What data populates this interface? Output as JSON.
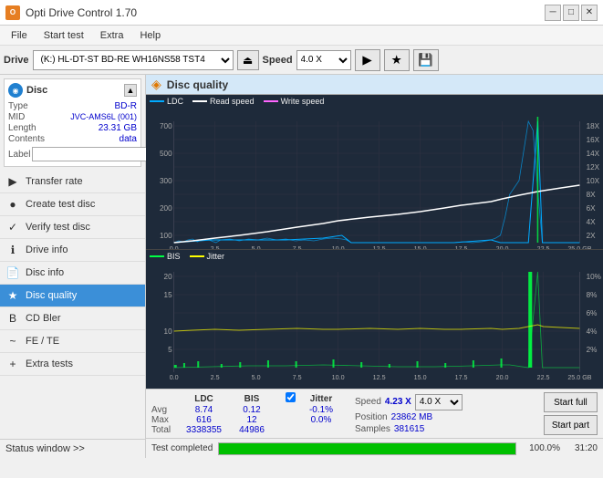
{
  "titlebar": {
    "title": "Opti Drive Control 1.70",
    "icon_text": "O",
    "min_btn": "─",
    "max_btn": "□",
    "close_btn": "✕"
  },
  "menubar": {
    "items": [
      "File",
      "Start test",
      "Extra",
      "Help"
    ]
  },
  "toolbar": {
    "drive_label": "Drive",
    "drive_value": "(K:) HL-DT-ST BD-RE WH16NS58 TST4",
    "speed_label": "Speed",
    "speed_value": "4.0 X"
  },
  "disc": {
    "header": "Disc",
    "fields": [
      {
        "label": "Type",
        "value": "BD-R"
      },
      {
        "label": "MID",
        "value": "JVC-AMS6L (001)"
      },
      {
        "label": "Length",
        "value": "23.31 GB"
      },
      {
        "label": "Contents",
        "value": "data"
      },
      {
        "label": "Label",
        "value": ""
      }
    ]
  },
  "sidebar_nav": {
    "items": [
      {
        "label": "Transfer rate",
        "icon": "▶"
      },
      {
        "label": "Create test disc",
        "icon": "●"
      },
      {
        "label": "Verify test disc",
        "icon": "✓"
      },
      {
        "label": "Drive info",
        "icon": "ℹ"
      },
      {
        "label": "Disc info",
        "icon": "📄"
      },
      {
        "label": "Disc quality",
        "icon": "★",
        "active": true
      },
      {
        "label": "CD Bler",
        "icon": "B"
      },
      {
        "label": "FE / TE",
        "icon": "~"
      },
      {
        "label": "Extra tests",
        "icon": "+"
      }
    ]
  },
  "status_window": {
    "label": "Status window >>",
    "bottom_text": "Test completed"
  },
  "chart": {
    "title": "Disc quality",
    "icon": "◈",
    "top_legend": [
      "LDC",
      "Read speed",
      "Write speed"
    ],
    "bottom_legend": [
      "BIS",
      "Jitter"
    ],
    "top": {
      "y_left_max": 700,
      "y_right_labels": [
        "18X",
        "16X",
        "14X",
        "12X",
        "10X",
        "8X",
        "6X",
        "4X",
        "2X"
      ],
      "x_labels": [
        "0.0",
        "2.5",
        "5.0",
        "7.5",
        "10.0",
        "12.5",
        "15.0",
        "17.5",
        "20.0",
        "22.5",
        "25.0 GB"
      ]
    },
    "bottom": {
      "y_left_max": 20,
      "y_right_labels": [
        "10%",
        "8%",
        "6%",
        "4%",
        "2%"
      ],
      "x_labels": [
        "0.0",
        "2.5",
        "5.0",
        "7.5",
        "10.0",
        "12.5",
        "15.0",
        "17.5",
        "20.0",
        "22.5",
        "25.0 GB"
      ]
    }
  },
  "stats": {
    "headers": [
      "LDC",
      "BIS",
      "",
      "Jitter",
      "Speed",
      ""
    ],
    "avg_label": "Avg",
    "avg_ldc": "8.74",
    "avg_bis": "0.12",
    "avg_jitter": "-0.1%",
    "max_label": "Max",
    "max_ldc": "616",
    "max_bis": "12",
    "max_jitter": "0.0%",
    "total_label": "Total",
    "total_ldc": "3338355",
    "total_bis": "44986",
    "speed_val": "4.23 X",
    "speed_select": "4.0 X",
    "position_label": "Position",
    "position_val": "23862 MB",
    "samples_label": "Samples",
    "samples_val": "381615",
    "jitter_checked": true,
    "jitter_label": "Jitter"
  },
  "progress": {
    "percent": 100,
    "percent_text": "100.0%",
    "time_text": "31:20"
  },
  "buttons": {
    "start_full": "Start full",
    "start_part": "Start part"
  }
}
